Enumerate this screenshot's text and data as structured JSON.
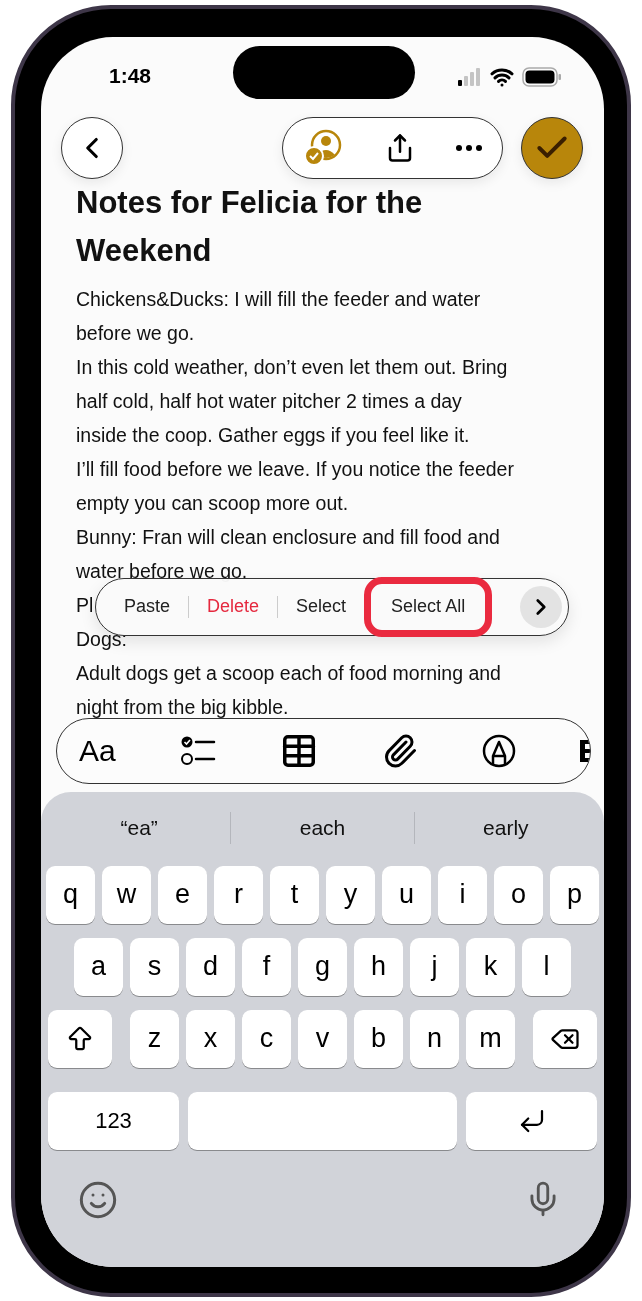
{
  "status_bar": {
    "time": "1:48"
  },
  "note": {
    "title": "Notes for Felicia for the Weekend",
    "lines": [
      {
        "text": "Chickens&Ducks: I will fill the feeder and water",
        "faded": false
      },
      {
        "text": "before we go.",
        "faded": false
      },
      {
        "text": "In this cold weather, don’t even let them out. Bring",
        "faded": false
      },
      {
        "text": "half cold, half hot water pitcher 2 times a day",
        "faded": false
      },
      {
        "text": "inside the coop. Gather eggs if you feel like it.",
        "faded": false
      },
      {
        "text": "I’ll fill food before we leave. If you notice the feeder",
        "faded": false
      },
      {
        "text": "empty you can scoop more out.",
        "faded": false
      },
      {
        "text": "Bunny: Fran will clean enclosure and fill food and",
        "faded": false
      },
      {
        "text": "water before we go.",
        "faded": false
      },
      {
        "text": "Pl",
        "faded": false
      },
      {
        "text": "Dogs:",
        "faded": false
      },
      {
        "text": "Adult dogs get a scoop each of food morning and",
        "faded": false
      },
      {
        "text": "night from the big kibble.",
        "faded": false
      }
    ]
  },
  "context_menu": {
    "items": [
      {
        "label": "Paste",
        "kind": "normal",
        "highlighted": false
      },
      {
        "label": "Delete",
        "kind": "destructive",
        "highlighted": false
      },
      {
        "label": "Select",
        "kind": "normal",
        "highlighted": false
      },
      {
        "label": "Select All",
        "kind": "normal",
        "highlighted": true
      }
    ]
  },
  "format_toolbar": {
    "text_style_label": "Aa"
  },
  "keyboard": {
    "suggestions": [
      "“ea”",
      "each",
      "early"
    ],
    "rows": [
      [
        "q",
        "w",
        "e",
        "r",
        "t",
        "y",
        "u",
        "i",
        "o",
        "p"
      ],
      [
        "a",
        "s",
        "d",
        "f",
        "g",
        "h",
        "j",
        "k",
        "l"
      ],
      [
        "z",
        "x",
        "c",
        "v",
        "b",
        "n",
        "m"
      ]
    ],
    "number_key": "123"
  }
}
